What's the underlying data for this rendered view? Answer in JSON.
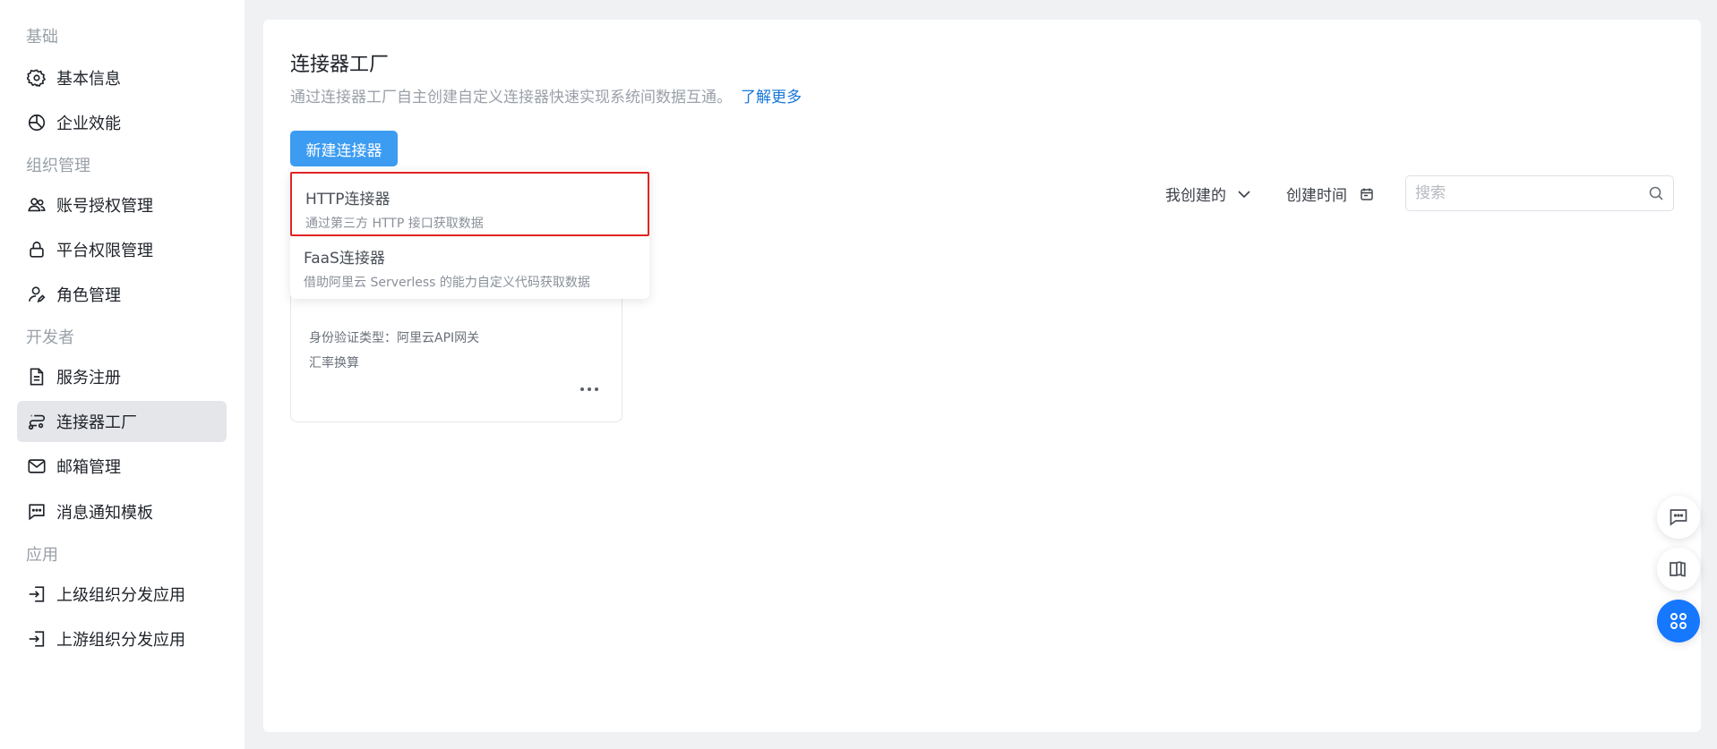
{
  "sidebar": {
    "sections": [
      {
        "title": "基础"
      },
      {
        "title": "组织管理"
      },
      {
        "title": "开发者"
      },
      {
        "title": "应用"
      }
    ],
    "items": [
      {
        "label": "基本信息",
        "icon": "gear-icon"
      },
      {
        "label": "企业效能",
        "icon": "pie-chart-icon"
      },
      {
        "label": "账号授权管理",
        "icon": "users-icon"
      },
      {
        "label": "平台权限管理",
        "icon": "lock-icon"
      },
      {
        "label": "角色管理",
        "icon": "user-edit-icon"
      },
      {
        "label": "服务注册",
        "icon": "document-icon"
      },
      {
        "label": "连接器工厂",
        "icon": "connector-icon",
        "active": true
      },
      {
        "label": "邮箱管理",
        "icon": "mail-icon"
      },
      {
        "label": "消息通知模板",
        "icon": "message-icon"
      },
      {
        "label": "上级组织分发应用",
        "icon": "login-icon"
      },
      {
        "label": "上游组织分发应用",
        "icon": "login-icon"
      }
    ]
  },
  "main": {
    "title": "连接器工厂",
    "description": "通过连接器工厂自主创建自定义连接器快速实现系统间数据互通。",
    "learn_more": "了解更多",
    "new_button": "新建连接器",
    "dropdown": [
      {
        "title": "HTTP连接器",
        "subtitle": "通过第三方 HTTP 接口获取数据"
      },
      {
        "title": "FaaS连接器",
        "subtitle": "借助阿里云 Serverless 的能力自定义代码获取数据"
      }
    ],
    "filters": {
      "mine": "我创建的",
      "time": "创建时间",
      "search_placeholder": "搜索"
    },
    "card": {
      "auth_type": "身份验证类型：阿里云API网关",
      "name": "汇率换算"
    }
  },
  "colors": {
    "accent": "#1677ff",
    "button": "#3c9cf2",
    "highlight_border": "#e02424"
  }
}
